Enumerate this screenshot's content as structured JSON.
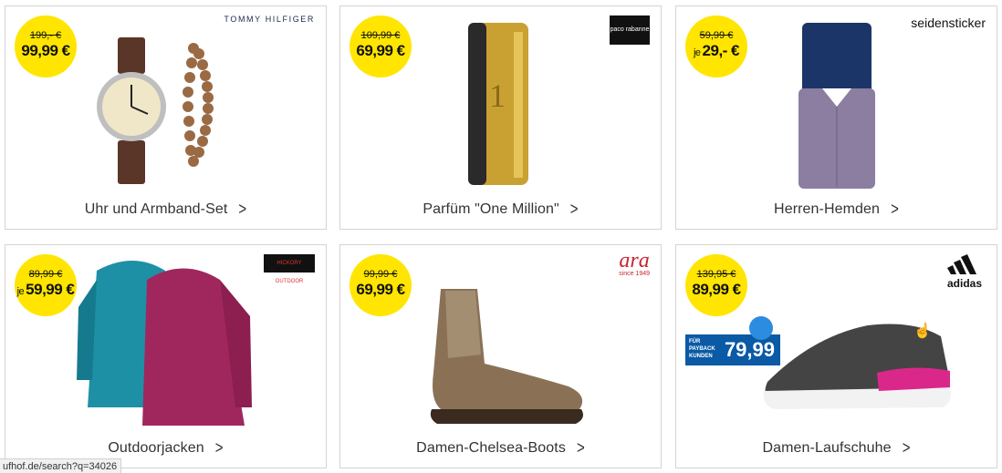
{
  "products": [
    {
      "label": "Uhr und Armband-Set",
      "old": "199,- €",
      "price": "99,99 €",
      "je": "",
      "brand": "TOMMY HILFIGER"
    },
    {
      "label": "Parfüm \"One Million\"",
      "old": "109,99 €",
      "price": "69,99 €",
      "je": "",
      "brand": "paco rabanne"
    },
    {
      "label": "Herren-Hemden",
      "old": "59,99 €",
      "price": "29,- €",
      "je": "je",
      "brand": "seidensticker"
    },
    {
      "label": "Outdoorjacken",
      "old": "89,99 €",
      "price": "59,99 €",
      "je": "je",
      "brand": "HICKORY OUTDOOR"
    },
    {
      "label": "Damen-Chelsea-Boots",
      "old": "99,99 €",
      "price": "69,99 €",
      "je": "",
      "brand": "ara",
      "brand_sub": "since 1949"
    },
    {
      "label": "Damen-Laufschuhe",
      "old": "139,95 €",
      "price": "89,99 €",
      "je": "",
      "brand": "adidas",
      "payback": {
        "line1": "FÜR",
        "line2": "PAYBACK",
        "line3": "KUNDEN",
        "price": "79,99"
      }
    }
  ],
  "status_url": "ufhof.de/search?q=34026",
  "colors": {
    "badge": "#ffe500",
    "payback": "#0a5aa5",
    "border": "#d4d4d4"
  }
}
